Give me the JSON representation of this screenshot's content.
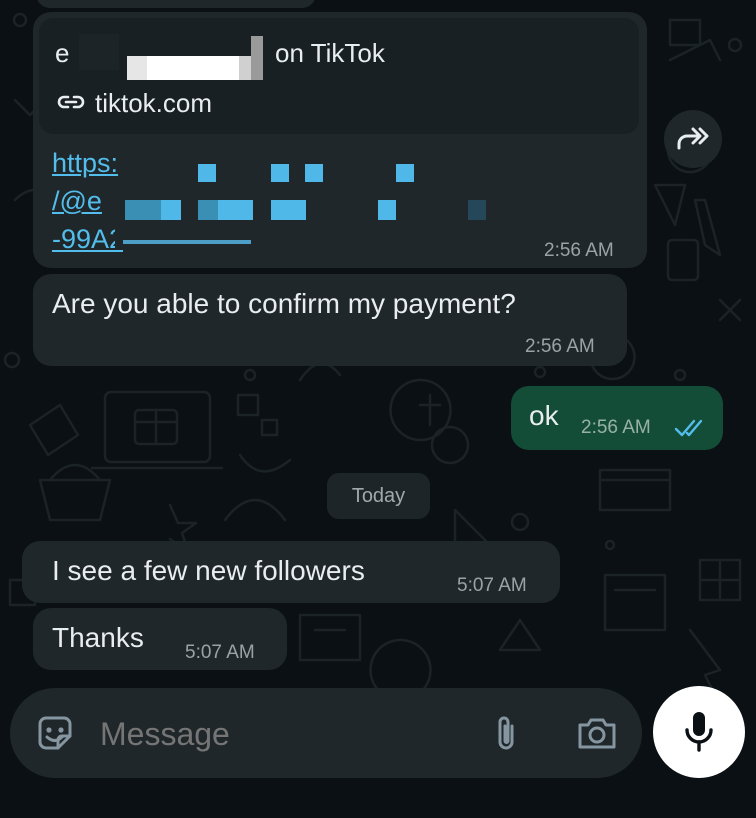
{
  "colors": {
    "background": "#0b1014",
    "incoming_bubble": "#1f272a",
    "outgoing_bubble": "#144d37",
    "link": "#53bdeb",
    "read_ticks": "#53bdeb",
    "mic_button": "#ffffff"
  },
  "link_message": {
    "preview_title_prefix": "e",
    "preview_title_suffix": "on TikTok",
    "preview_domain": "tiktok.com",
    "link_line_1": "https:",
    "link_line_2": "/@e",
    "link_line_3": "-99A2",
    "time": "2:56 AM"
  },
  "messages": [
    {
      "text": "Are you able to confirm my payment?",
      "time": "2:56 AM",
      "direction": "incoming"
    },
    {
      "text": "ok",
      "time": "2:56 AM",
      "direction": "outgoing",
      "status": "read"
    },
    {
      "text": "I see a few new followers",
      "time": "5:07 AM",
      "direction": "incoming"
    },
    {
      "text": "Thanks",
      "time": "5:07 AM",
      "direction": "incoming"
    }
  ],
  "date_divider": "Today",
  "composer": {
    "placeholder": "Message",
    "icons": [
      "sticker-icon",
      "paperclip-icon",
      "camera-icon",
      "microphone-icon"
    ]
  },
  "forward_icon": "forward-icon"
}
